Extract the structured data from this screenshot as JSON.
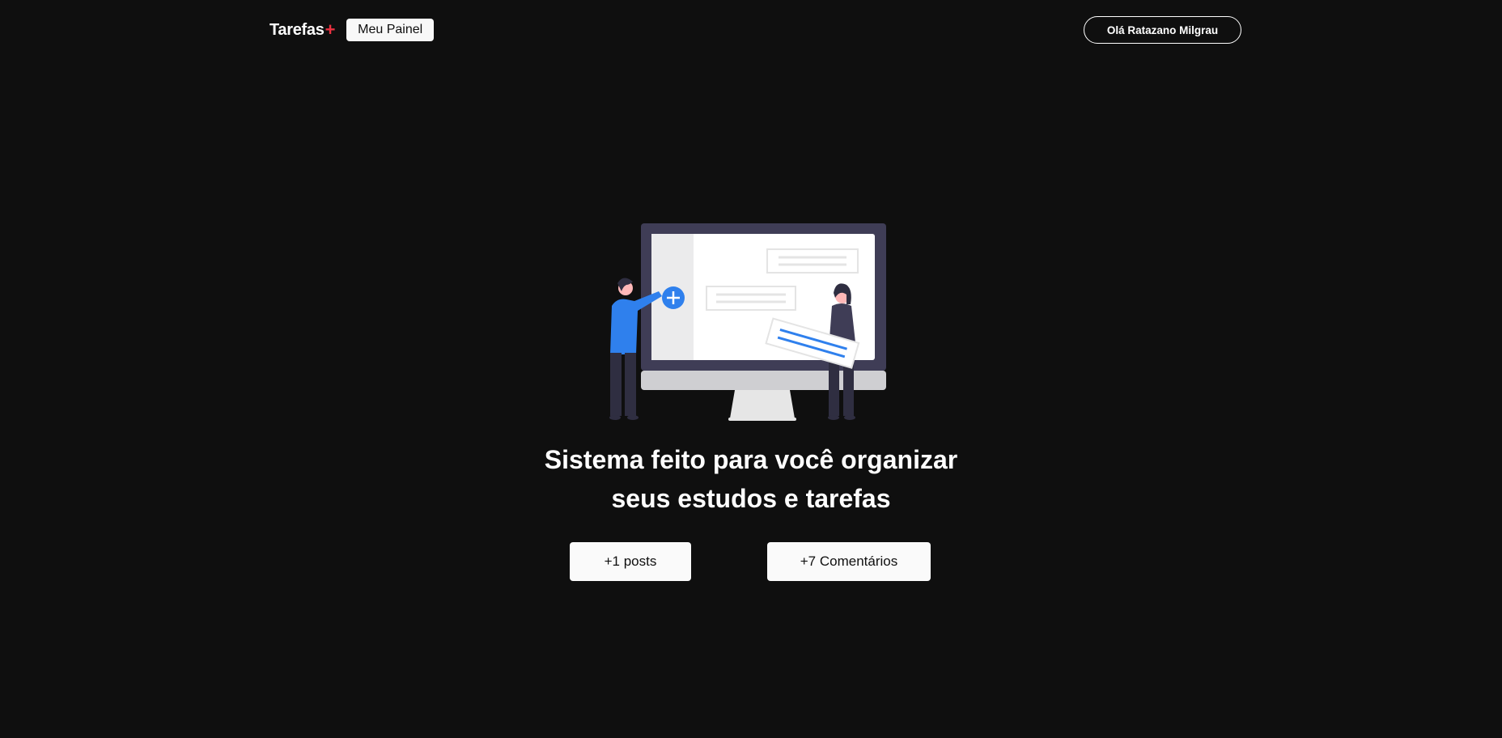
{
  "header": {
    "logo_text": "Tarefas",
    "logo_accent": "+",
    "nav_button_label": "Meu Painel",
    "user_button_label": "Olá Ratazano Milgrau"
  },
  "hero": {
    "title_line1": "Sistema feito para você organizar",
    "title_line2": "seus estudos e tarefas",
    "illustration_icon": "people-with-monitor-illustration"
  },
  "stats": {
    "posts_label": "+1 posts",
    "comments_label": "+7 Comentários"
  },
  "colors": {
    "background": "#0f0f0f",
    "accent": "#ea3140",
    "illustration_blue": "#2f80ed",
    "monitor_frame": "#3f3d56"
  }
}
